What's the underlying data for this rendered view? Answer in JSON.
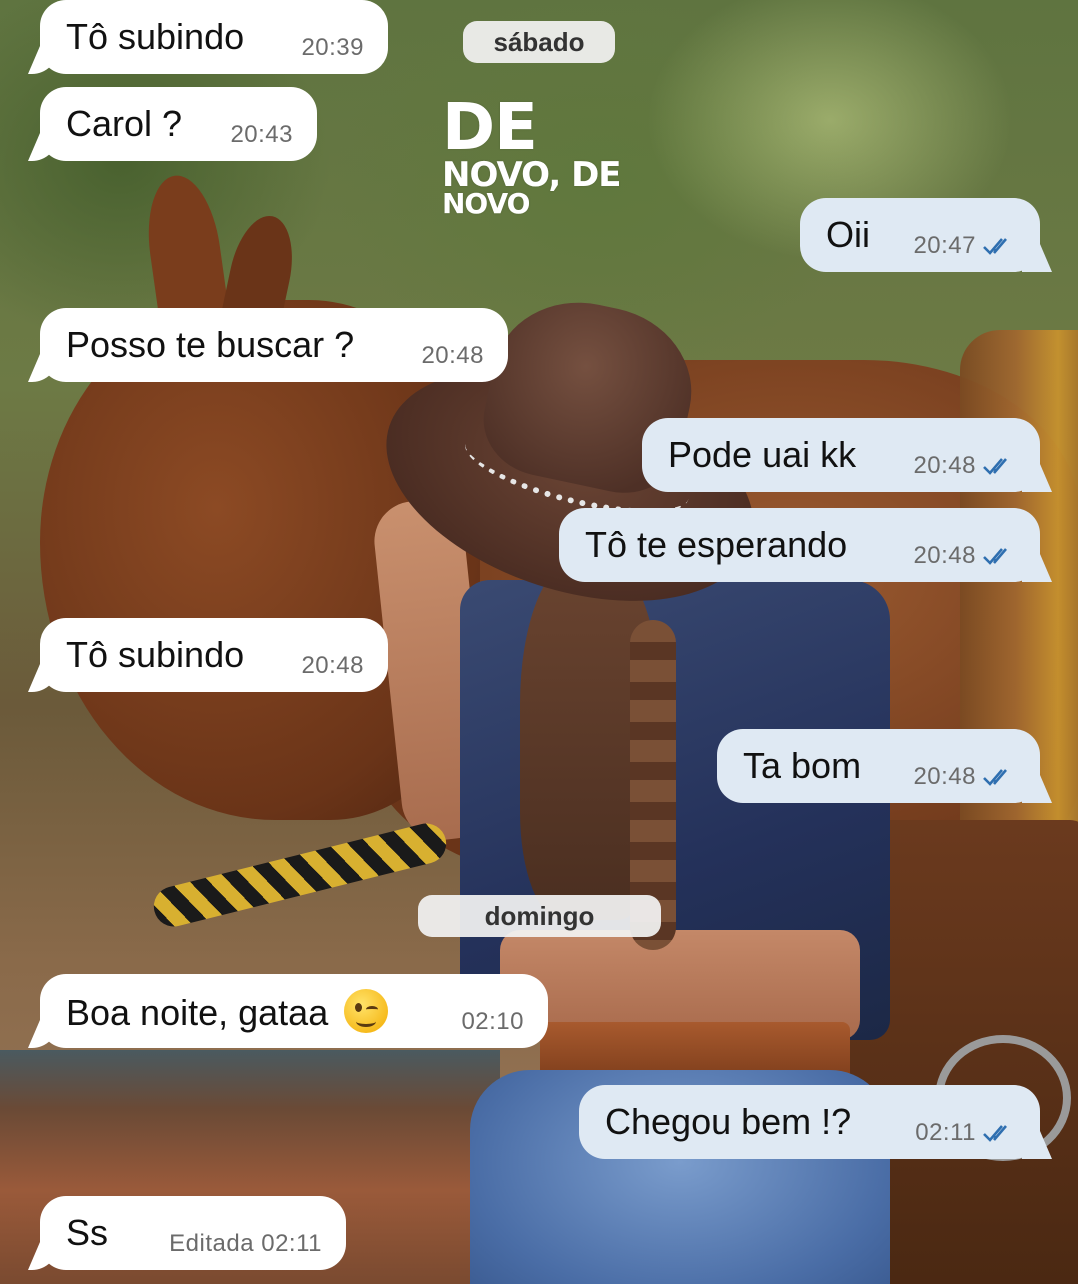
{
  "sticker": {
    "line1": "DE",
    "line2": "NOVO, DE",
    "line3": "NOVO"
  },
  "dates": {
    "saturday": "sábado",
    "sunday": "domingo"
  },
  "messages": [
    {
      "dir": "in",
      "text": "Tô subindo",
      "time": "20:39"
    },
    {
      "dir": "in",
      "text": "Carol ?",
      "time": "20:43"
    },
    {
      "dir": "out",
      "text": "Oii",
      "time": "20:47",
      "status": "read"
    },
    {
      "dir": "in",
      "text": "Posso te buscar ?",
      "time": "20:48"
    },
    {
      "dir": "out",
      "text": "Pode uai kk",
      "time": "20:48",
      "status": "read"
    },
    {
      "dir": "out",
      "text": "Tô te esperando",
      "time": "20:48",
      "status": "read"
    },
    {
      "dir": "in",
      "text": "Tô subindo",
      "time": "20:48"
    },
    {
      "dir": "out",
      "text": "Ta bom",
      "time": "20:48",
      "status": "read"
    },
    {
      "dir": "in",
      "text": "Boa noite, gataa",
      "time": "02:10",
      "emoji": "winking-face"
    },
    {
      "dir": "out",
      "text": "Chegou bem !?",
      "time": "02:11",
      "status": "read"
    },
    {
      "dir": "in",
      "text": "Ss",
      "time": "Editada 02:11"
    }
  ],
  "colors": {
    "incoming_bubble": "#ffffff",
    "outgoing_bubble": "#dfe9f3",
    "read_ticks": "#2f6fb0",
    "meta_text": "#6b6b6b"
  }
}
